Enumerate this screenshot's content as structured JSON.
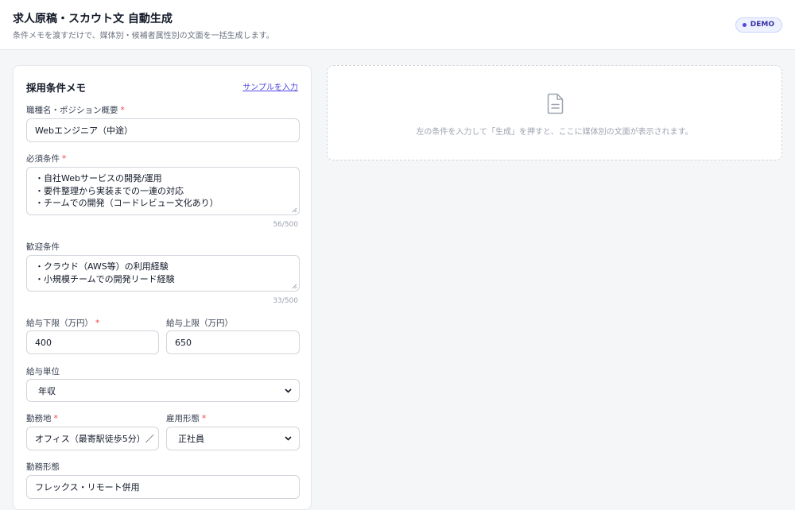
{
  "header": {
    "title": "求人原稿・スカウト文 自動生成",
    "subtitle": "条件メモを渡すだけで、媒体別・候補者属性別の文面を一括生成します。",
    "badge": "DEMO"
  },
  "form": {
    "title": "採用条件メモ",
    "sample_link": "サンプルを入力",
    "required_mark": "*",
    "job_title": {
      "label": "職種名・ポジション概要",
      "value": "Webエンジニア（中途）"
    },
    "must": {
      "label": "必須条件",
      "lines": [
        "・自社Webサービスの開発/運用",
        "・要件整理から実装までの一連の対応",
        "・チームでの開発（コードレビュー文化あり）"
      ],
      "counter": "56/500"
    },
    "welcome": {
      "label": "歓迎条件",
      "lines": [
        "・クラウド（AWS等）の利用経験",
        "・小規模チームでの開発リード経験"
      ],
      "counter": "33/500"
    },
    "salary_min": {
      "label": "給与下限（万円）",
      "value": "400"
    },
    "salary_max": {
      "label": "給与上限（万円）",
      "value": "650"
    },
    "salary_unit": {
      "label": "給与単位",
      "value": "年収"
    },
    "location": {
      "label": "勤務地",
      "value": "オフィス（最寄駅徒歩5分）／"
    },
    "employment": {
      "label": "雇用形態",
      "value": "正社員"
    },
    "work_style": {
      "label": "勤務形態",
      "value": "フレックス・リモート併用"
    }
  },
  "output": {
    "empty_message": "左の条件を入力して「生成」を押すと、ここに媒体別の文面が表示されます。",
    "icon": "document-icon"
  },
  "colors": {
    "accent": "#4f46e5",
    "required": "#ef4444",
    "border": "#d1d5db"
  }
}
